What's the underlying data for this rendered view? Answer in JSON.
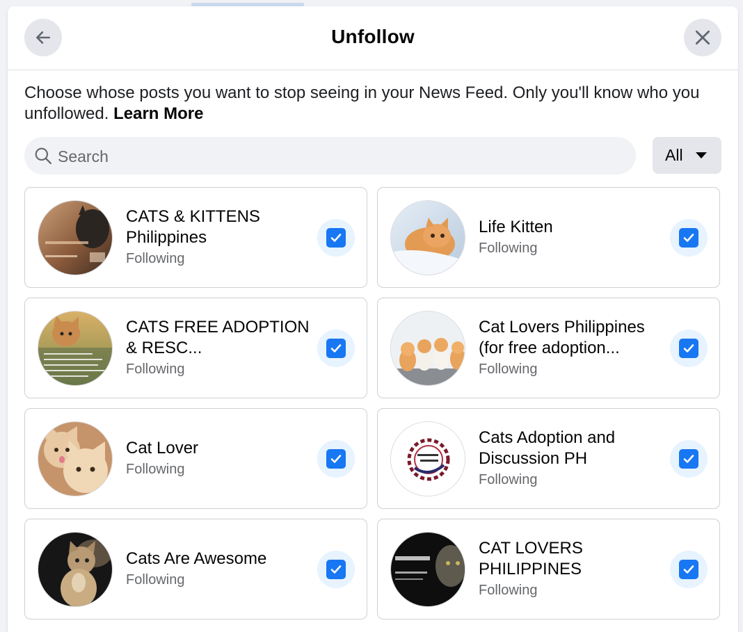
{
  "dialog": {
    "title": "Unfollow",
    "back_icon": "arrow-left-icon",
    "close_icon": "close-icon",
    "description": "Choose whose posts you want to stop seeing in your News Feed. Only you'll know who you unfollowed.",
    "learn_more": "Learn More"
  },
  "search": {
    "placeholder": "Search",
    "value": ""
  },
  "filter": {
    "selected": "All"
  },
  "colors": {
    "accent": "#1877f2",
    "check_bg": "#e7f3ff",
    "button_bg": "#e4e6eb",
    "muted_text": "#65676b"
  },
  "items": [
    {
      "name": "CATS & KITTENS Philippines",
      "status": "Following",
      "checked": true
    },
    {
      "name": "Life Kitten",
      "status": "Following",
      "checked": true
    },
    {
      "name": "CATS FREE ADOPTION & RESC...",
      "status": "Following",
      "checked": true
    },
    {
      "name": "Cat Lovers Philippines (for free adoption...",
      "status": "Following",
      "checked": true
    },
    {
      "name": "Cat Lover",
      "status": "Following",
      "checked": true
    },
    {
      "name": "Cats Adoption and Discussion PH",
      "status": "Following",
      "checked": true
    },
    {
      "name": "Cats Are Awesome",
      "status": "Following",
      "checked": true
    },
    {
      "name": "CAT LOVERS PHILIPPINES",
      "status": "Following",
      "checked": true
    }
  ]
}
